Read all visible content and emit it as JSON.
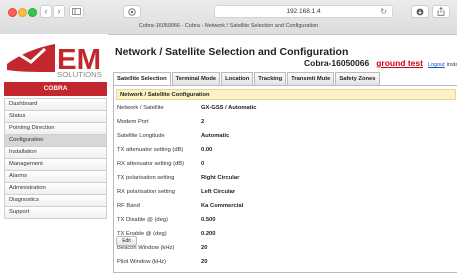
{
  "browser": {
    "url": "192.168.1.4",
    "tab_title": "Cobra-16050066 - Cobra - Network / Satellite Selection and Configuration"
  },
  "sidebar": {
    "brand": "COBRA",
    "items": [
      {
        "label": "Dashboard"
      },
      {
        "label": "Status"
      },
      {
        "label": "Pointing Direction"
      },
      {
        "label": "Configuration"
      },
      {
        "label": "Installation"
      },
      {
        "label": "Management"
      },
      {
        "label": "Alarms"
      },
      {
        "label": "Administration"
      },
      {
        "label": "Diagnostics"
      },
      {
        "label": "Support"
      }
    ]
  },
  "header": {
    "title": "Network / Satellite Selection and Configuration",
    "device": "Cobra-16050066",
    "mode": "ground test",
    "logout": "Logout",
    "install": "install"
  },
  "tabs": [
    {
      "label": "Satellite Selection"
    },
    {
      "label": "Terminal Mode"
    },
    {
      "label": "Location"
    },
    {
      "label": "Tracking"
    },
    {
      "label": "Transmit Mute"
    },
    {
      "label": "Safety Zones"
    }
  ],
  "section": {
    "title": "Network / Satellite Configuration",
    "rows": [
      {
        "label": "Network / Satellite",
        "value": "GX-GSS / Automatic"
      },
      {
        "label": "Modem Port",
        "value": "2"
      },
      {
        "label": "Satellite Longitude",
        "value": "Automatic"
      },
      {
        "label": "TX attenuator setting (dB)",
        "value": "0.00"
      },
      {
        "label": "RX attenuator setting (dB)",
        "value": "0"
      },
      {
        "label": "TX polarisation setting",
        "value": "Right Circular"
      },
      {
        "label": "RX polarisation setting",
        "value": "Left Circular"
      },
      {
        "label": "RF Band",
        "value": "Ka Commercial"
      },
      {
        "label": "TX Disable @ (deg)",
        "value": "0.500"
      },
      {
        "label": "TX Enable @ (deg)",
        "value": "0.200"
      },
      {
        "label": "Beacon Window (kHz)",
        "value": "20"
      },
      {
        "label": "Pilot Window (kHz)",
        "value": "20"
      }
    ],
    "edit_label": "Edit"
  },
  "colors": {
    "brand_red": "#c1272d",
    "mode_red": "#d0021b",
    "section_header_bg": "#fbf1c3",
    "link_blue": "#1a4fc1"
  },
  "icons": [
    "close-light",
    "minimize-light",
    "zoom-light",
    "back-icon",
    "forward-icon",
    "sidebar-toggle-icon",
    "privacy-icon",
    "reload-icon",
    "download-icon",
    "share-icon",
    "em-solutions-logo",
    "globe-icon"
  ]
}
